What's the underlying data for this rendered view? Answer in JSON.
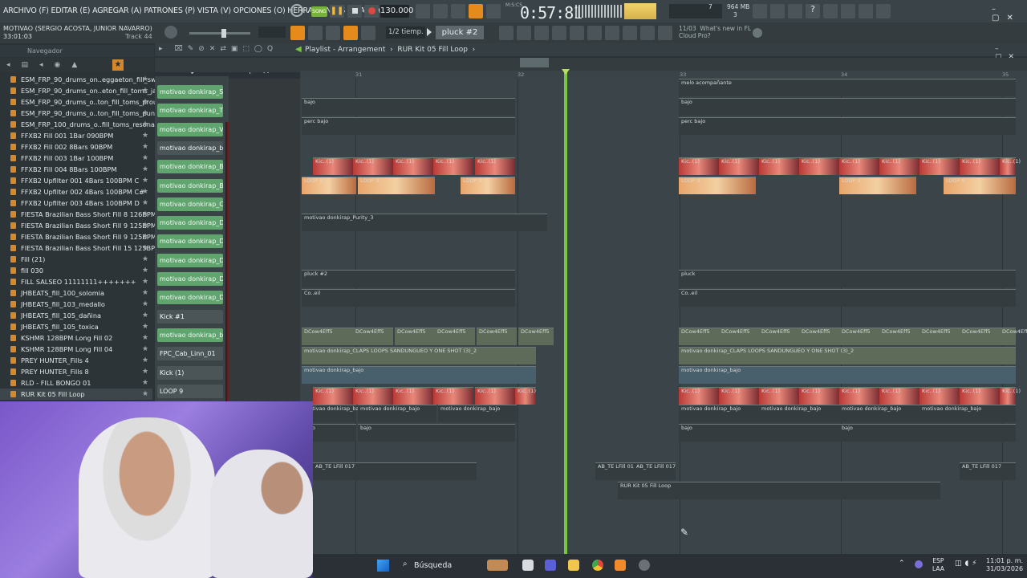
{
  "menubar": {
    "menu_text": "ARCHIVO (F) EDITAR (E) AGREGAR (A) PATRONES (P) VISTA (V) OPCIONES (O) HERRAMIENTAS (T) AYUDA",
    "song_mode": "SONG",
    "tempo": "130.000",
    "time": "0:57:81",
    "time_label": "M:S:CS",
    "cpu_value": "7",
    "memory": "964 MB",
    "memory_sub": "3"
  },
  "song_info": {
    "title": "MOTIVAO (SERGIO ACOSTA, JUNIOR NAVARRO)",
    "time": "33:01:03",
    "track_label": "Track 44"
  },
  "toolbar": {
    "snap": "1/2 tiemp.",
    "pattern": "pluck #2",
    "news_date": "11/03",
    "news_title": "What's new in FL",
    "news_sub": "Cloud Pro?"
  },
  "browser": {
    "title": "Navegador",
    "items": [
      {
        "label": "ESM_FRP_90_drums_on..eggaeton_fill_swing"
      },
      {
        "label": "ESM_FRP_90_drums_on..eton_fill_toms_jack"
      },
      {
        "label": "ESM_FRP_90_drums_o..ton_fill_toms_proud"
      },
      {
        "label": "ESM_FRP_90_drums_o..ton_fill_toms_punch"
      },
      {
        "label": "ESM_FRP_100_drums_o..fill_toms_resonate"
      },
      {
        "label": "FFXB2 Fill 001 1Bar 090BPM"
      },
      {
        "label": "FFXB2 Fill 002 8Bars 90BPM"
      },
      {
        "label": "FFXB2 Fill 003 1Bar 100BPM"
      },
      {
        "label": "FFXB2 Fill 004 8Bars 100BPM"
      },
      {
        "label": "FFXB2 Upfilter 001 4Bars 100BPM C"
      },
      {
        "label": "FFXB2 Upfilter 002 4Bars 100BPM C#"
      },
      {
        "label": "FFXB2 Upfilter 003 4Bars 100BPM D"
      },
      {
        "label": "FIESTA Brazilian Bass Short Fill 8 126BPM"
      },
      {
        "label": "FIESTA Brazilian Bass Short Fill 9 125BPM"
      },
      {
        "label": "FIESTA Brazilian Bass Short Fill 9 125BPM"
      },
      {
        "label": "FIESTA Brazilian Bass Short Fill 15 125BPM"
      },
      {
        "label": "Fill (21)"
      },
      {
        "label": "fill 030"
      },
      {
        "label": "FILL SALSEO 11111111+++++++"
      },
      {
        "label": "JHBEATS_fill_100_solomia"
      },
      {
        "label": "JHBEATS_fill_103_medallo"
      },
      {
        "label": "JHBEATS_fill_105_dañina"
      },
      {
        "label": "JHBEATS_fill_105_toxica"
      },
      {
        "label": "KSHMR 128BPM Long Fill 02"
      },
      {
        "label": "KSHMR 128BPM Long Fill 04"
      },
      {
        "label": "PREY HUNTER_Fills 4"
      },
      {
        "label": "PREY HUNTER_Fills 8"
      },
      {
        "label": "RLD - FILL BONGO 01"
      },
      {
        "label": "RUR Kit 05 Fill Loop"
      }
    ]
  },
  "channels": [
    {
      "label": "motivao donkirap_S..",
      "style": "g"
    },
    {
      "label": "motivao donkirap_TS..",
      "style": "g"
    },
    {
      "label": "motivao donkirap_V..",
      "style": "g"
    },
    {
      "label": "motivao donkirap_b..",
      "style": "d"
    },
    {
      "label": "motivao donkirap_B..",
      "style": "g"
    },
    {
      "label": "motivao donkirap_B..",
      "style": "g"
    },
    {
      "label": "motivao donkirap_CL..",
      "style": "g"
    },
    {
      "label": "motivao donkirap_D..",
      "style": "g"
    },
    {
      "label": "motivao donkirap_D..",
      "style": "g"
    },
    {
      "label": "motivao donkirap_D..",
      "style": "g"
    },
    {
      "label": "motivao donkirap_D..",
      "style": "g"
    },
    {
      "label": "motivao donkirap_D..",
      "style": "g"
    },
    {
      "label": "Kick #1",
      "style": "d"
    },
    {
      "label": "motivao donkirap_b..",
      "style": "g"
    },
    {
      "label": "FPC_Cab_Linn_01",
      "style": "d"
    },
    {
      "label": "Kick (1)",
      "style": "d"
    },
    {
      "label": "LOOP 9",
      "style": "d"
    }
  ],
  "playlist": {
    "title": "Playlist - Arrangement",
    "breadcrumb": "RUR Kit 05 Fill Loop",
    "bars": [
      "31",
      "32",
      "33",
      "34",
      "35"
    ],
    "clips": [
      {
        "label": "melo acompañante"
      },
      {
        "label": "bajo"
      },
      {
        "label": "perc bajo"
      },
      {
        "label": "Kic..(1)"
      },
      {
        "label": "LOOP 9"
      },
      {
        "label": "motivao donkirap_Purity_3"
      },
      {
        "label": "pluck #2"
      },
      {
        "label": "pluck"
      },
      {
        "label": "Co..eil"
      },
      {
        "label": "DCow4Eff5"
      },
      {
        "label": "motivao donkirap_CLAPS LOOPS SANDUNGUEO Y ONE SHOT (3)_2"
      },
      {
        "label": "motivao donkirap_bajo"
      },
      {
        "label": "AB_TE LFill 017"
      },
      {
        "label": "RUR Kit 05 Fill Loop"
      }
    ]
  },
  "taskbar": {
    "search_label": "Búsqueda",
    "lang_top": "ESP",
    "lang_bottom": "LAA",
    "time": "11:01 p. m.",
    "date": "31/03/2026"
  },
  "colors": {
    "playhead": "#79c542",
    "channel_green": "#5fa56d",
    "accent_orange": "#e58b1c"
  }
}
